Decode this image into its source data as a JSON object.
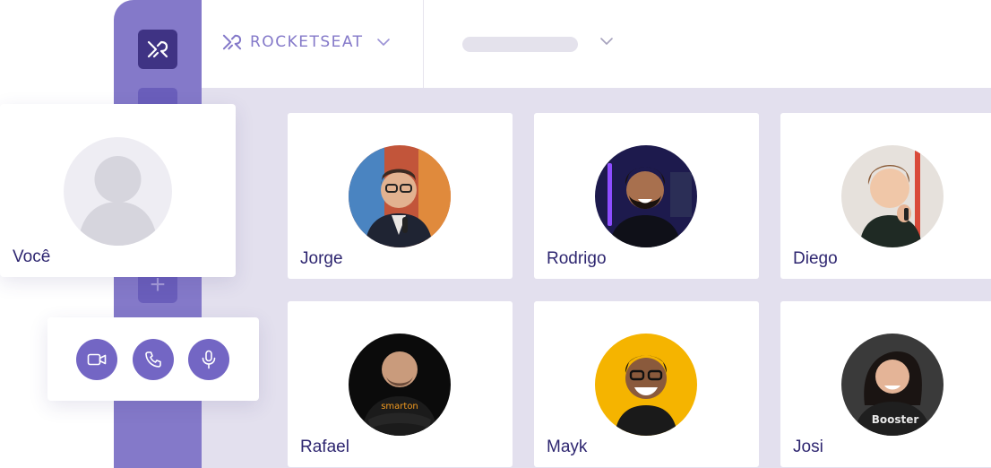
{
  "brand": {
    "name": "ROCKETSEAT",
    "icon": "rocketseat-logo-icon"
  },
  "header": {
    "selector_icon": "chevron-down-icon"
  },
  "sidebar": {
    "add_icon": "plus-icon",
    "add_label": "+"
  },
  "self": {
    "name": "Você",
    "avatar_icon": "user-placeholder-icon"
  },
  "participants": [
    {
      "name": "Jorge"
    },
    {
      "name": "Rodrigo"
    },
    {
      "name": "Diego"
    },
    {
      "name": "Rafael"
    },
    {
      "name": "Mayk"
    },
    {
      "name": "Josi"
    }
  ],
  "controls": [
    {
      "icon": "video-camera-icon"
    },
    {
      "icon": "phone-icon"
    },
    {
      "icon": "microphone-icon"
    }
  ],
  "colors": {
    "brand": "#8479c9",
    "brand_dark": "#3f3384",
    "control": "#7366c4",
    "text": "#2e2670",
    "content_bg": "#e3e0ee"
  }
}
